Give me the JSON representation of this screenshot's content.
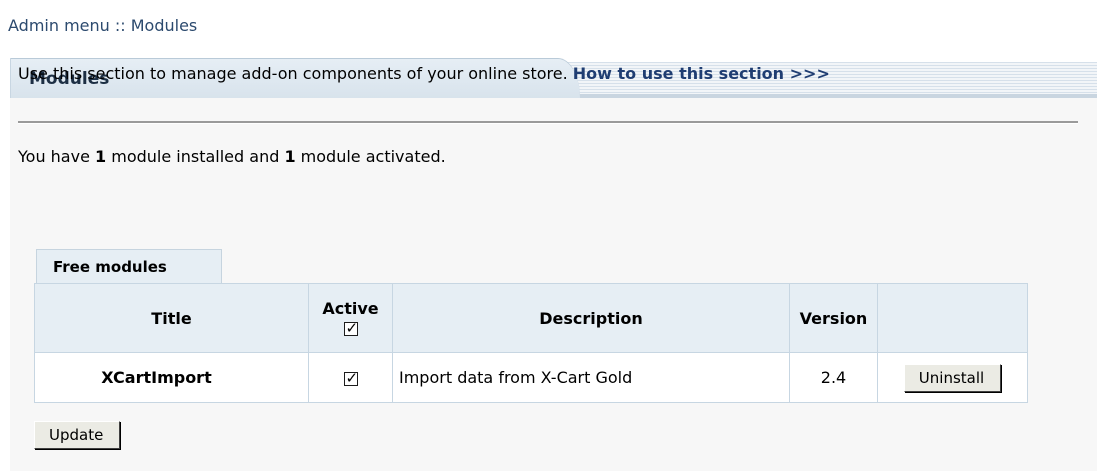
{
  "breadcrumb": {
    "text": "Admin menu :: Modules"
  },
  "panel": {
    "title": "Modules"
  },
  "intro": {
    "text": "Use this section to manage add-on components of your online store. ",
    "link": "How to use this section >>>"
  },
  "summary": {
    "prefix": "You have ",
    "installed_count": "1",
    "middle": " module installed and ",
    "activated_count": "1",
    "suffix": " module activated."
  },
  "tab": {
    "label": "Free modules"
  },
  "table": {
    "headers": {
      "title": "Title",
      "active": "Active",
      "description": "Description",
      "version": "Version"
    },
    "rows": [
      {
        "title": "XCartImport",
        "active": true,
        "description": "Import data from X-Cart Gold",
        "version": "2.4",
        "action_label": "Uninstall"
      }
    ]
  },
  "buttons": {
    "update": "Update"
  },
  "icons": {
    "checkmark": "checkmark-icon"
  }
}
